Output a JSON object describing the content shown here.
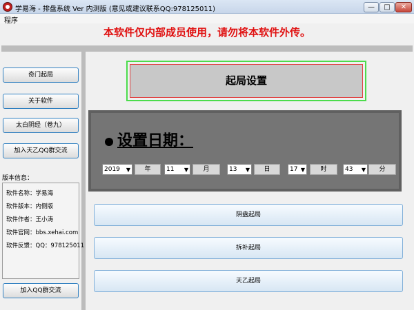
{
  "window": {
    "title": "学易海 - 排盘系统 Ver 内测版    (意见或建议联系QQ:978125011)",
    "minimize": "—",
    "maximize": "□",
    "close": "✕"
  },
  "menu": {
    "program": "程序"
  },
  "banner": "本软件仅内部成员使用，请勿将本软件外传。",
  "sidebar": {
    "buttons": [
      "奇门起局",
      "关于软件",
      "太白阴经（卷九）",
      "加入天乙QQ群交流"
    ],
    "version_title": "版本信息：",
    "version_lines": [
      "软件名称：学易海",
      "软件版本：内侧版",
      "软件作者：王小涛",
      "软件官网：bbs.xehai.com",
      "软件反馈：QQ：978125011"
    ],
    "qq_button": "加入QQ群交流"
  },
  "main": {
    "setup_title": "起局设置",
    "date_heading": "设置日期：",
    "date_fields": [
      {
        "value": "2019",
        "unit": "年"
      },
      {
        "value": "11",
        "unit": "月"
      },
      {
        "value": "13",
        "unit": "日"
      },
      {
        "value": "17",
        "unit": "时"
      },
      {
        "value": "43",
        "unit": "分"
      }
    ],
    "buttons": [
      "阴盘起局",
      "拆补起局",
      "天乙起局"
    ]
  }
}
